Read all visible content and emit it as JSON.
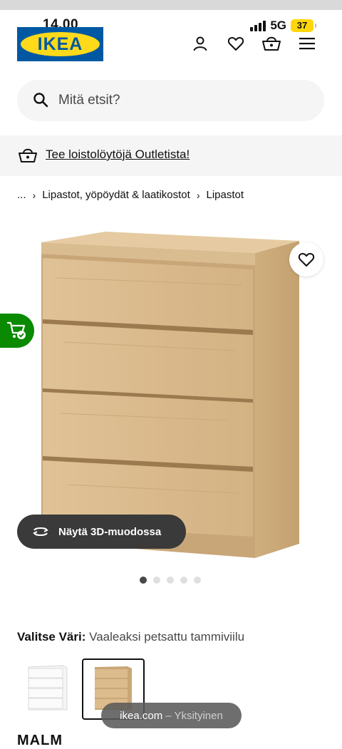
{
  "status_bar": {
    "time": "14.00",
    "network": "5G",
    "battery": "37"
  },
  "header": {
    "logo_text": "IKEA",
    "icons": [
      "user-icon",
      "heart-icon",
      "basket-icon",
      "menu-icon"
    ]
  },
  "search": {
    "placeholder": "Mitä etsit?"
  },
  "promo": {
    "text": "Tee loistolöytöjä Outletista!"
  },
  "breadcrumb": {
    "items": [
      "...",
      "Lipastot, yöpöydät & laatikostot",
      "Lipastot"
    ]
  },
  "gallery": {
    "view_3d_label": "Näytä 3D-muodossa",
    "image_count": 5,
    "active_index": 0
  },
  "color": {
    "label": "Valitse Väri:",
    "value": "Vaaleaksi petsattu tammiviilu",
    "swatches": [
      "white",
      "oak"
    ],
    "selected": 1
  },
  "product": {
    "name": "MALM"
  },
  "toast": {
    "domain": "ikea.com",
    "mode": "– Yksityinen"
  },
  "colors": {
    "ikea_blue": "#0058a3",
    "ikea_yellow": "#ffda1a",
    "cart_green": "#0a8a00"
  }
}
